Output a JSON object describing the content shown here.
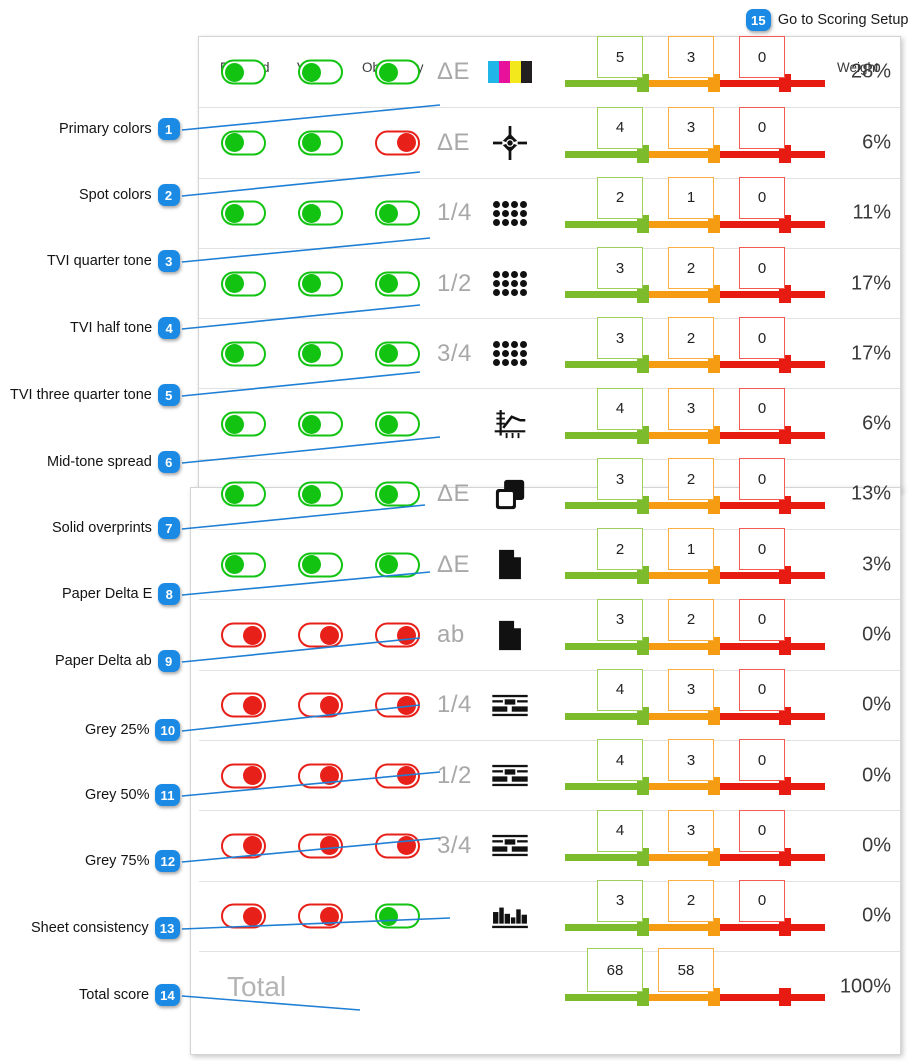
{
  "top_link": {
    "badge": "15",
    "label": "Go to Scoring Setup"
  },
  "columns": {
    "enabled": "Enabled",
    "visible": "Visible",
    "obligatory": "Obligatory",
    "weight": "Weight"
  },
  "total_label": "Total",
  "rows": [
    {
      "callout": "Primary colors",
      "badge": "1",
      "enabled": "on",
      "visible": "on",
      "obligatory": "on",
      "metric": "ΔE",
      "icon": "cmyk-bars-icon",
      "green": "5",
      "orange": "3",
      "red": "0",
      "weight": "28%"
    },
    {
      "callout": "Spot colors",
      "badge": "2",
      "enabled": "on",
      "visible": "on",
      "obligatory": "off",
      "metric": "ΔE",
      "icon": "registration-mark-icon",
      "green": "4",
      "orange": "3",
      "red": "0",
      "weight": "6%"
    },
    {
      "callout": "TVI quarter tone",
      "badge": "3",
      "enabled": "on",
      "visible": "on",
      "obligatory": "on",
      "metric": "1/4",
      "icon": "halftone-dots-icon",
      "green": "2",
      "orange": "1",
      "red": "0",
      "weight": "11%"
    },
    {
      "callout": "TVI half tone",
      "badge": "4",
      "enabled": "on",
      "visible": "on",
      "obligatory": "on",
      "metric": "1/2",
      "icon": "halftone-dots-icon",
      "green": "3",
      "orange": "2",
      "red": "0",
      "weight": "17%"
    },
    {
      "callout": "TVI three quarter tone",
      "badge": "5",
      "enabled": "on",
      "visible": "on",
      "obligatory": "on",
      "metric": "3/4",
      "icon": "halftone-dots-icon",
      "green": "3",
      "orange": "2",
      "red": "0",
      "weight": "17%"
    },
    {
      "callout": "Mid-tone spread",
      "badge": "6",
      "enabled": "on",
      "visible": "on",
      "obligatory": "on",
      "metric": "",
      "icon": "curve-chart-icon",
      "green": "4",
      "orange": "3",
      "red": "0",
      "weight": "6%"
    },
    {
      "callout": "Solid overprints",
      "badge": "7",
      "enabled": "on",
      "visible": "on",
      "obligatory": "on",
      "metric": "ΔE",
      "icon": "overlap-squares-icon",
      "green": "3",
      "orange": "2",
      "red": "0",
      "weight": "13%"
    },
    {
      "callout": "Paper Delta E",
      "badge": "8",
      "enabled": "on",
      "visible": "on",
      "obligatory": "on",
      "metric": "ΔE",
      "icon": "page-icon",
      "green": "2",
      "orange": "1",
      "red": "0",
      "weight": "3%"
    },
    {
      "callout": "Paper Delta ab",
      "badge": "9",
      "enabled": "off",
      "visible": "off",
      "obligatory": "off",
      "metric": "ab",
      "icon": "page-icon",
      "green": "3",
      "orange": "2",
      "red": "0",
      "weight": "0%"
    },
    {
      "callout": "Grey 25%",
      "badge": "10",
      "enabled": "off",
      "visible": "off",
      "obligatory": "off",
      "metric": "1/4",
      "icon": "grey-balance-icon",
      "green": "4",
      "orange": "3",
      "red": "0",
      "weight": "0%"
    },
    {
      "callout": "Grey 50%",
      "badge": "11",
      "enabled": "off",
      "visible": "off",
      "obligatory": "off",
      "metric": "1/2",
      "icon": "grey-balance-icon",
      "green": "4",
      "orange": "3",
      "red": "0",
      "weight": "0%"
    },
    {
      "callout": "Grey 75%",
      "badge": "12",
      "enabled": "off",
      "visible": "off",
      "obligatory": "off",
      "metric": "3/4",
      "icon": "grey-balance-icon",
      "green": "4",
      "orange": "3",
      "red": "0",
      "weight": "0%"
    },
    {
      "callout": "Sheet consistency",
      "badge": "13",
      "enabled": "off",
      "visible": "off",
      "obligatory": "on",
      "metric": "",
      "icon": "sheet-consistency-icon",
      "green": "3",
      "orange": "2",
      "red": "0",
      "weight": "0%"
    }
  ],
  "total_row": {
    "callout": "Total score",
    "badge": "14",
    "green": "68",
    "orange": "58",
    "weight": "100%"
  },
  "colors": {
    "badge_blue": "#1b8ae5",
    "leader_blue": "#1f7fd4",
    "toggle_on": "#12c312",
    "toggle_off": "#e8201a",
    "bar_green": "#7cbc2c",
    "bar_orange": "#f59c12",
    "bar_red": "#e81b12"
  }
}
